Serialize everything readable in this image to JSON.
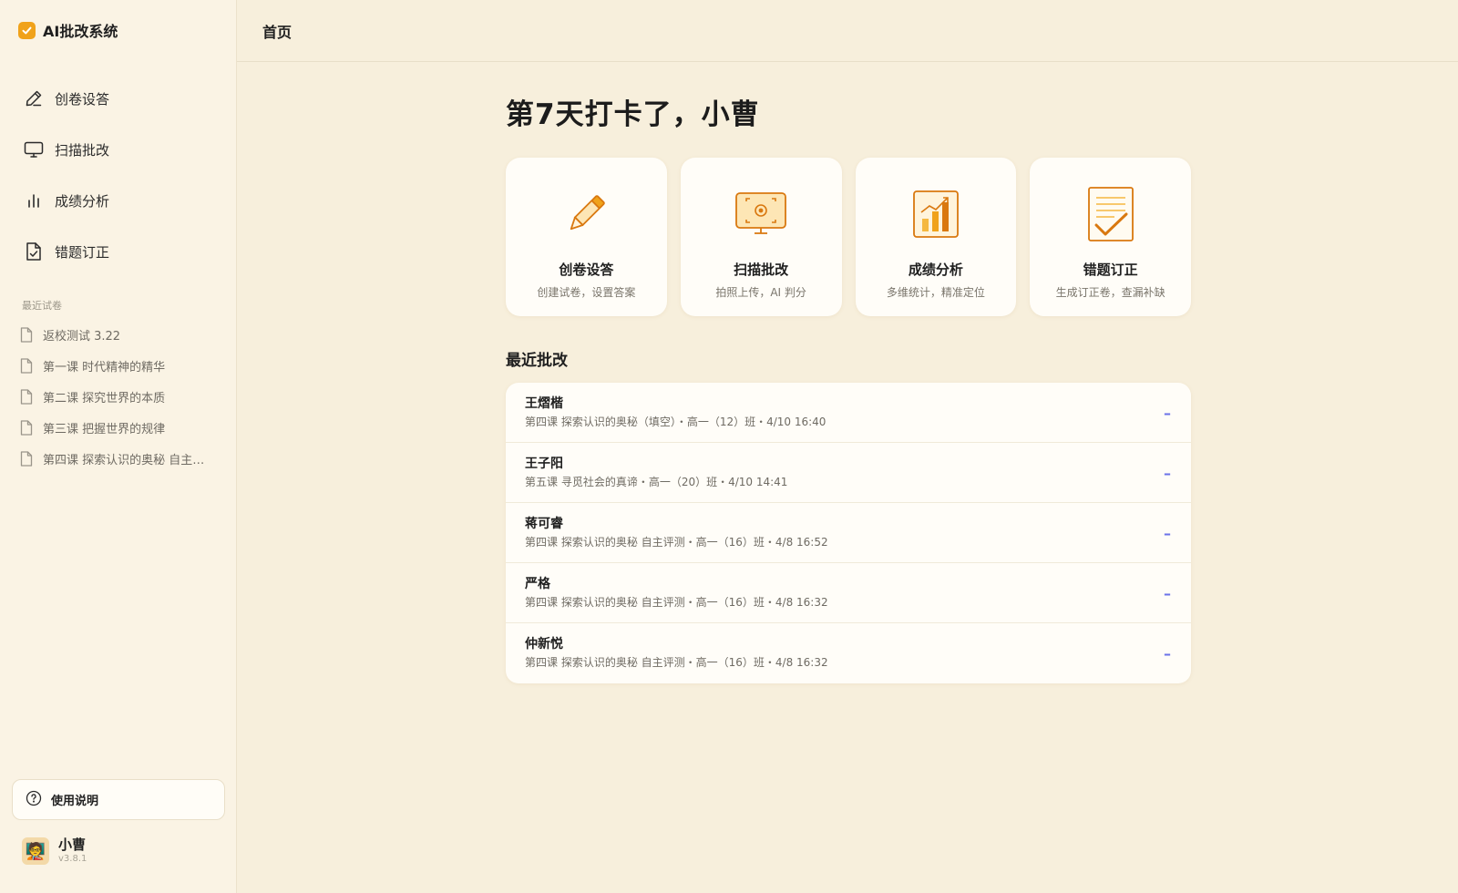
{
  "app": {
    "title": "AI批改系统"
  },
  "sidebar": {
    "nav": [
      {
        "label": "创卷设答",
        "icon": "pen-icon"
      },
      {
        "label": "扫描批改",
        "icon": "monitor-icon"
      },
      {
        "label": "成绩分析",
        "icon": "bar-chart-icon"
      },
      {
        "label": "错题订正",
        "icon": "document-check-icon"
      }
    ],
    "recent_title": "最近试卷",
    "recent": [
      "返校测试 3.22",
      "第一课 时代精神的精华",
      "第二课 探究世界的本质",
      "第三课 把握世界的规律",
      "第四课 探索认识的奥秘 自主…"
    ],
    "help_label": "使用说明",
    "user": {
      "name": "小曹",
      "version": "v3.8.1",
      "avatar": "🧑‍🏫"
    }
  },
  "header": {
    "title": "首页"
  },
  "main": {
    "greeting": "第7天打卡了，小曹",
    "cards": [
      {
        "title": "创卷设答",
        "subtitle": "创建试卷，设置答案",
        "icon": "pencil-icon"
      },
      {
        "title": "扫描批改",
        "subtitle": "拍照上传，AI 判分",
        "icon": "scanner-monitor-icon"
      },
      {
        "title": "成绩分析",
        "subtitle": "多维统计，精准定位",
        "icon": "growth-chart-icon"
      },
      {
        "title": "错题订正",
        "subtitle": "生成订正卷，查漏补缺",
        "icon": "checklist-icon"
      }
    ],
    "recent_section_title": "最近批改",
    "recent_grading": [
      {
        "name": "王熠楷",
        "meta": "第四课 探索认识的奥秘（填空）・高一（12）班・4/10 16:40",
        "score": "–"
      },
      {
        "name": "王子阳",
        "meta": "第五课 寻觅社会的真谛・高一（20）班・4/10 14:41",
        "score": "–"
      },
      {
        "name": "蒋可睿",
        "meta": "第四课 探索认识的奥秘 自主评测・高一（16）班・4/8 16:52",
        "score": "–"
      },
      {
        "name": "严格",
        "meta": "第四课 探索认识的奥秘 自主评测・高一（16）班・4/8 16:32",
        "score": "–"
      },
      {
        "name": "仲新悦",
        "meta": "第四课 探索认识的奥秘 自主评测・高一（16）班・4/8 16:32",
        "score": "–"
      }
    ]
  },
  "colors": {
    "accent": "#f0a21a",
    "icon_orange": "#e0841a",
    "score": "#6b72e8",
    "background": "#f7efdc"
  }
}
